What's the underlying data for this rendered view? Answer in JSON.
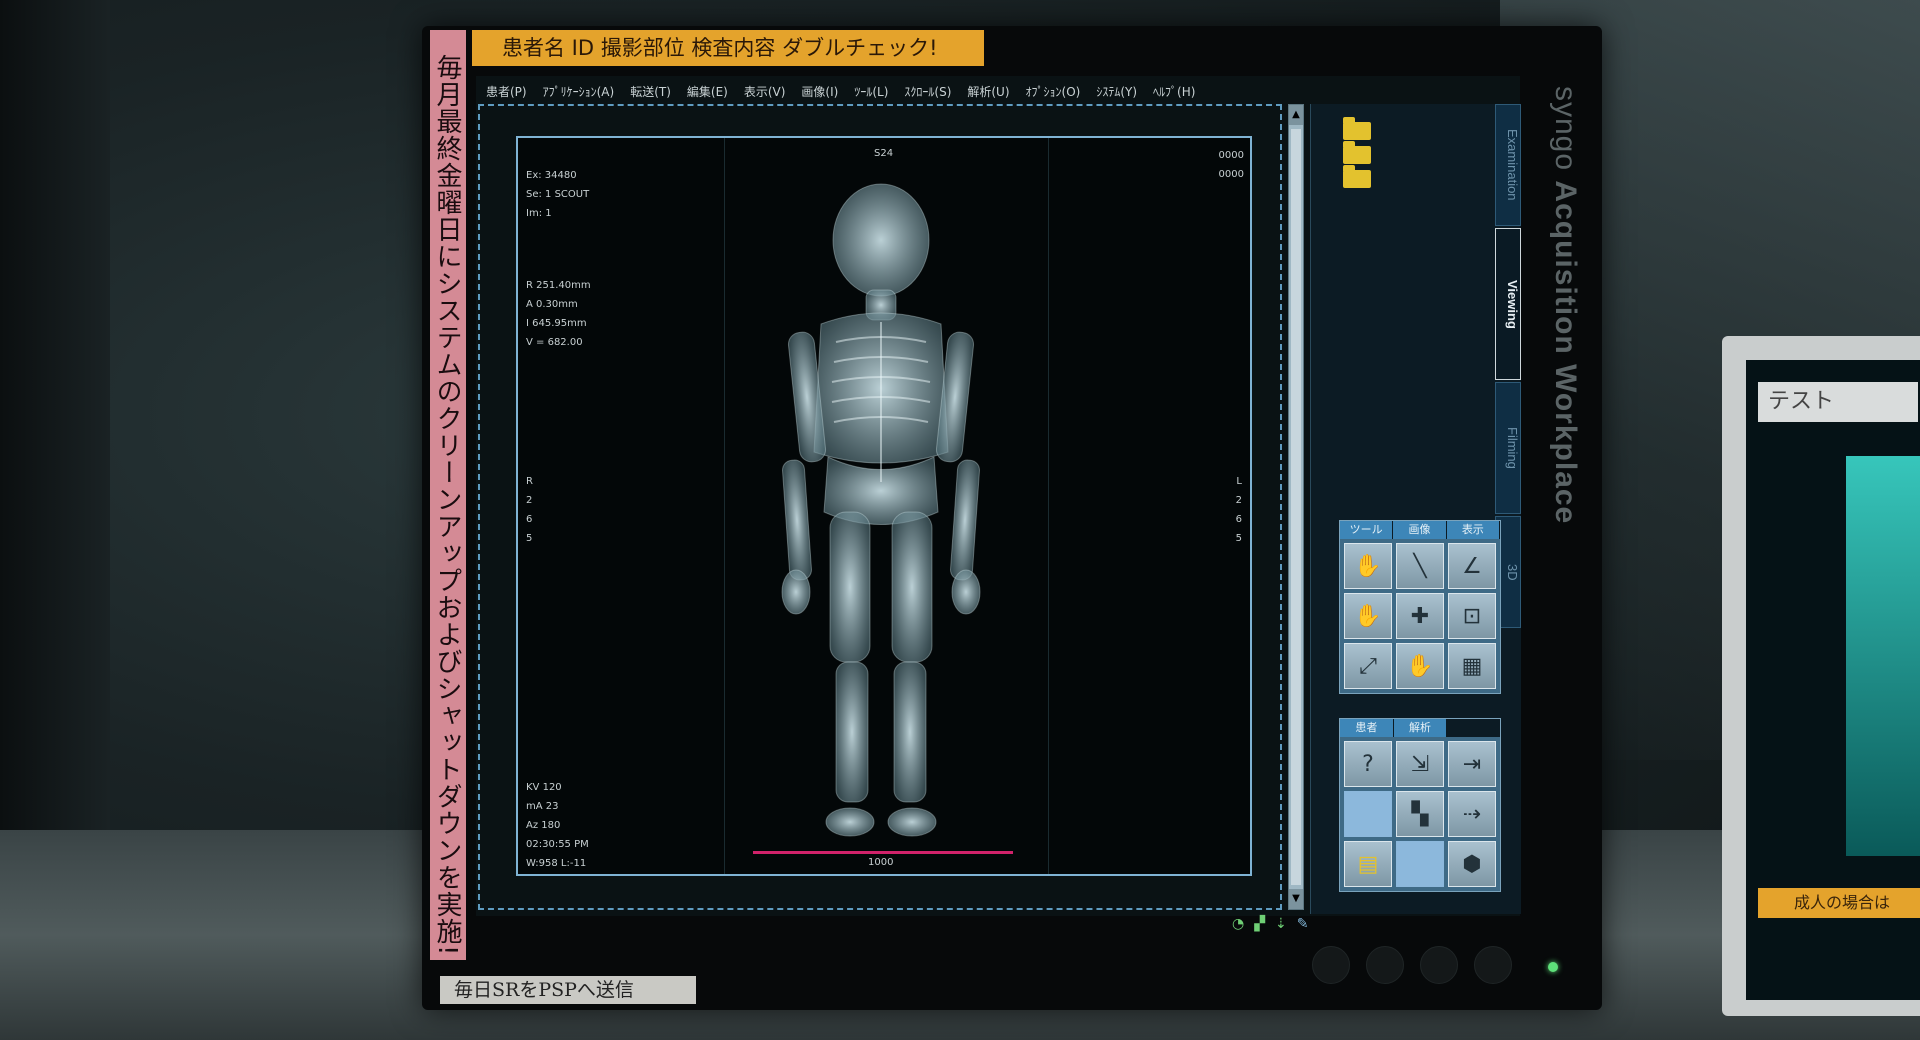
{
  "notes": {
    "top": "患者名 ID 撮影部位 検査内容 ダブルチェック!",
    "side": "毎月最終金曜日にシステムのクリーンアップおよびシャットダウンを実施!",
    "bottom": "毎日SRをPSPへ送信"
  },
  "brand": {
    "light": "syngo",
    "bold": "Acquisition Workplace"
  },
  "menu": [
    "患者(P)",
    "ｱﾌﾟﾘｹｰｼｮﾝ(A)",
    "転送(T)",
    "編集(E)",
    "表示(V)",
    "画像(I)",
    "ﾂｰﾙ(L)",
    "ｽｸﾛｰﾙ(S)",
    "解析(U)",
    "ｵﾌﾟｼｮﾝ(O)",
    "ｼｽﾃﾑ(Y)",
    "ﾍﾙﾌﾟ(H)"
  ],
  "viewer": {
    "top_center": "S24",
    "top_right": [
      "0000",
      "0000"
    ],
    "top_left": [
      "Ex: 34480",
      "Se: 1 SCOUT",
      "Im: 1"
    ],
    "geometry": [
      "R 251.40mm",
      "A 0.30mm",
      "I 645.95mm",
      "V = 682.00"
    ],
    "orient_left": [
      "R",
      "2",
      "6",
      "5"
    ],
    "orient_right": [
      "L",
      "2",
      "6",
      "5"
    ],
    "tech": [
      "KV 120",
      "mA 23",
      "Az 180",
      "02:30:55 PM",
      "W:958 L:-11"
    ],
    "scale_label": "1000"
  },
  "tabs": {
    "examination": "Examination",
    "viewing": "Viewing",
    "filming": "Filming",
    "threed": "3D"
  },
  "tool_panel": {
    "headers": [
      "ツール",
      "画像",
      "表示"
    ]
  },
  "patient_panel": {
    "headers": [
      "患者",
      "解析"
    ]
  },
  "monitor2": {
    "label": "テスト",
    "note": "成人の場合は"
  }
}
